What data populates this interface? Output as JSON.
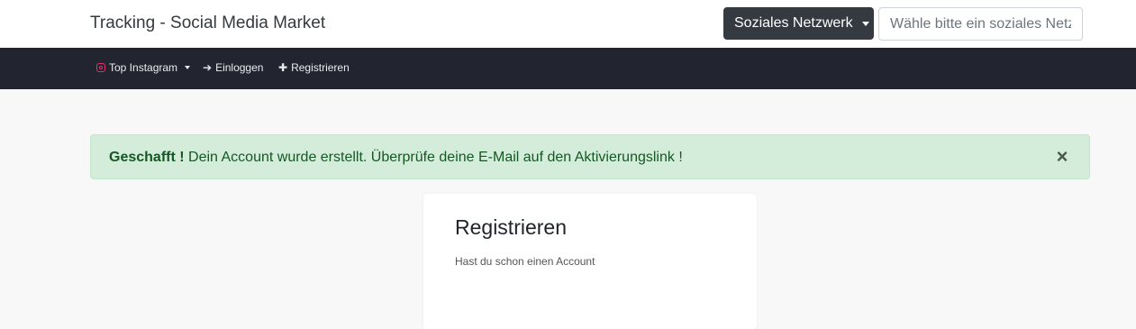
{
  "header": {
    "brand": "Tracking - Social Media Market",
    "network_dropdown_label": "Soziales Netzwerk",
    "network_search_placeholder": "Wähle bitte ein soziales Netzwerk"
  },
  "navbar": {
    "items": [
      {
        "label": "Top Instagram",
        "icon": "instagram-icon",
        "has_dropdown": true
      },
      {
        "label": "Einloggen",
        "icon": "sign-in-icon"
      },
      {
        "label": "Registrieren",
        "icon": "plus-icon"
      }
    ]
  },
  "alert": {
    "strong": "Geschafft !",
    "message": "Dein Account wurde erstellt. Überprüfe deine E-Mail auf den Aktivierungslink !",
    "close_symbol": "×"
  },
  "register_card": {
    "title": "Registrieren",
    "subtitle": "Hast du schon einen Account"
  },
  "colors": {
    "navbar_bg": "#22252f",
    "alert_bg": "#d4eddb",
    "alert_text": "#155724",
    "dropdown_bg": "#343a40"
  }
}
